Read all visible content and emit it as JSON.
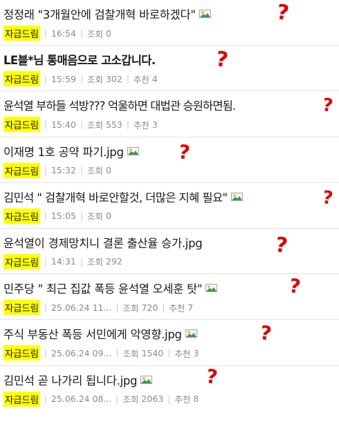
{
  "posts": [
    {
      "title": "정정래 \"3개월안에 검찰개혁 바로하겠다\"",
      "bold": false,
      "has_image": true,
      "author": "자급드림",
      "time": "16:54",
      "views_label": "조회",
      "views": "0",
      "rec_label": "",
      "recs": ""
    },
    {
      "title": "LE블*님 통매음으로 고소갑니다.",
      "bold": true,
      "has_image": false,
      "author": "자급드림",
      "time": "15:59",
      "views_label": "조회",
      "views": "302",
      "rec_label": "추천",
      "recs": "4"
    },
    {
      "title": "윤석열 부하들 석방??? 억울하면 대법관 승원하면됨.",
      "bold": false,
      "has_image": false,
      "author": "자급드림",
      "time": "15:40",
      "views_label": "조회",
      "views": "553",
      "rec_label": "추천",
      "recs": "3"
    },
    {
      "title": "이재명 1호 공약 파기.jpg",
      "bold": false,
      "has_image": true,
      "author": "자급드림",
      "time": "15:32",
      "views_label": "조회",
      "views": "0",
      "rec_label": "",
      "recs": ""
    },
    {
      "title": "김민석 \" 검찰개혁 바로안할것, 더많은 지혜 필요\"",
      "bold": false,
      "has_image": true,
      "author": "자급드림",
      "time": "15:05",
      "views_label": "조회",
      "views": "0",
      "rec_label": "",
      "recs": ""
    },
    {
      "title": "윤석열이 경제망치니 결론 출산율 승가.jpg",
      "bold": false,
      "has_image": false,
      "author": "자급드림",
      "time": "14:31",
      "views_label": "조회",
      "views": "292",
      "rec_label": "",
      "recs": ""
    },
    {
      "title": "민주당 \" 최근 집값 폭등 윤석열 오세훈 탓\"",
      "bold": false,
      "has_image": true,
      "author": "자급드림",
      "time": "25.06.24 11...",
      "views_label": "조회",
      "views": "720",
      "rec_label": "추천",
      "recs": "7"
    },
    {
      "title": "주식 부동산 폭등 서민에게 악영향.jpg",
      "bold": false,
      "has_image": true,
      "author": "자급드림",
      "time": "25.06.24 09...",
      "views_label": "조회",
      "views": "1540",
      "rec_label": "추천",
      "recs": "3"
    },
    {
      "title": "김민석 곧 나가리 됩니다.jpg",
      "bold": false,
      "has_image": true,
      "author": "자급드림",
      "time": "25.06.24 08...",
      "views_label": "조회",
      "views": "2063",
      "rec_label": "추천",
      "recs": "8"
    }
  ],
  "annotation_mark": "?",
  "colors": {
    "highlight": "#ffff00",
    "mark": "#e00000",
    "meta": "#8a8a8a"
  }
}
